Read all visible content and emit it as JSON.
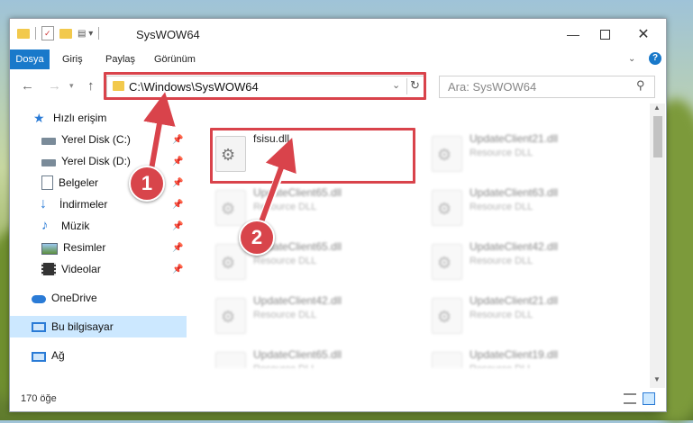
{
  "window": {
    "title": "SysWOW64"
  },
  "ribbon": {
    "tabs": [
      {
        "label": "Dosya",
        "active": true
      },
      {
        "label": "Giriş"
      },
      {
        "label": "Paylaş"
      },
      {
        "label": "Görünüm"
      }
    ]
  },
  "address": {
    "path": "C:\\Windows\\SysWOW64"
  },
  "search": {
    "placeholder": "Ara: SysWOW64"
  },
  "sidebar": {
    "items": [
      {
        "label": "Hızlı erişim",
        "icon": "star-icon"
      },
      {
        "label": "Yerel Disk (C:)",
        "icon": "drive-icon",
        "pinned": true
      },
      {
        "label": "Yerel Disk (D:)",
        "icon": "drive-icon",
        "pinned": true
      },
      {
        "label": "Belgeler",
        "icon": "document-icon",
        "pinned": true
      },
      {
        "label": "İndirmeler",
        "icon": "download-icon",
        "pinned": true
      },
      {
        "label": "Müzik",
        "icon": "music-icon",
        "pinned": true
      },
      {
        "label": "Resimler",
        "icon": "pictures-icon",
        "pinned": true
      },
      {
        "label": "Videolar",
        "icon": "video-icon",
        "pinned": true
      },
      {
        "label": "OneDrive",
        "icon": "cloud-icon"
      },
      {
        "label": "Bu bilgisayar",
        "icon": "computer-icon",
        "selected": true
      },
      {
        "label": "Ağ",
        "icon": "network-icon"
      }
    ]
  },
  "files": [
    {
      "name": "fsisu.dll",
      "type": "",
      "highlighted": true
    },
    {
      "name": "UpdateClient21.dll",
      "type": "Resource DLL"
    },
    {
      "name": "UpdateClient65.dll",
      "type": "Resource DLL"
    },
    {
      "name": "UpdateClient63.dll",
      "type": "Resource DLL"
    },
    {
      "name": "UpdateClient65.dll",
      "type": "Resource DLL"
    },
    {
      "name": "UpdateClient42.dll",
      "type": "Resource DLL"
    },
    {
      "name": "UpdateClient42.dll",
      "type": "Resource DLL"
    },
    {
      "name": "UpdateClient21.dll",
      "type": "Resource DLL"
    },
    {
      "name": "UpdateClient65.dll",
      "type": "Resource DLL"
    },
    {
      "name": "UpdateClient19.dll",
      "type": "Resource DLL"
    }
  ],
  "status": {
    "count": "170 öğe"
  },
  "annotations": {
    "step1": "1",
    "step2": "2"
  },
  "colors": {
    "accent": "#1979ca",
    "highlight": "#d9434b",
    "selection": "#cce8ff"
  }
}
